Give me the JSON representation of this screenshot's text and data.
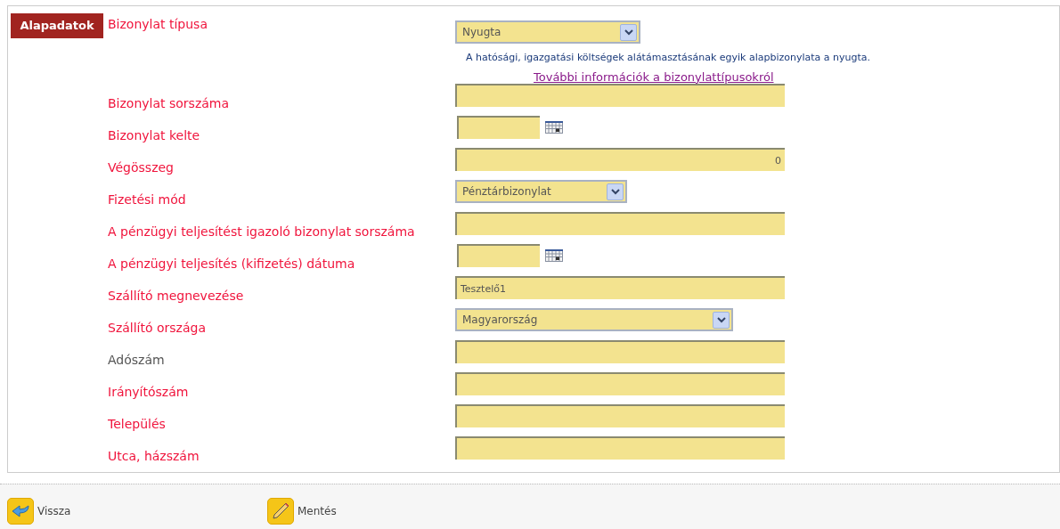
{
  "section_tab": "Alapadatok",
  "fields": [
    {
      "label": "Bizonylat típusa",
      "required": true,
      "kind": "select",
      "value": "Nyugta",
      "note": "A hatósági, igazgatási költségek alátámasztásának egyik alapbizonylata a nyugta.",
      "link": "További információk a bizonylattípusokról"
    },
    {
      "label": "Bizonylat sorszáma",
      "required": true,
      "kind": "text"
    },
    {
      "label": "Bizonylat kelte",
      "required": true,
      "kind": "date"
    },
    {
      "label": "Végösszeg",
      "required": true,
      "kind": "number",
      "value": "0"
    },
    {
      "label": "Fizetési mód",
      "required": true,
      "kind": "select",
      "value": "Pénztárbizonylat"
    },
    {
      "label": "A pénzügyi teljesítést igazoló bizonylat sorszáma",
      "required": true,
      "kind": "text"
    },
    {
      "label": "A pénzügyi teljesítés (kifizetés) dátuma",
      "required": true,
      "kind": "date"
    },
    {
      "label": "Szállító megnevezése",
      "required": true,
      "kind": "text",
      "value": "Tesztelő1"
    },
    {
      "label": "Szállító országa",
      "required": true,
      "kind": "select",
      "value": "Magyarország"
    },
    {
      "label": "Adószám",
      "required": false,
      "kind": "text"
    },
    {
      "label": "Irányítószám",
      "required": true,
      "kind": "text"
    },
    {
      "label": "Település",
      "required": true,
      "kind": "text"
    },
    {
      "label": "Utca, házszám",
      "required": true,
      "kind": "text"
    }
  ],
  "buttons": [
    {
      "label": "Vissza",
      "kind": "back"
    },
    {
      "label": "Mentés",
      "kind": "save"
    }
  ]
}
